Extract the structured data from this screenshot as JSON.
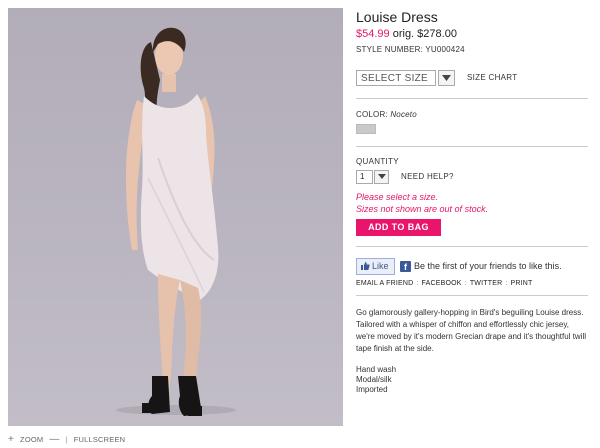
{
  "product": {
    "title": "Louise Dress",
    "sale_price": "$54.99",
    "orig_price": "orig. $278.00",
    "style_number": "STYLE NUMBER: YU000424"
  },
  "size": {
    "select_value": "SELECT SIZE",
    "size_chart_label": "SIZE CHART"
  },
  "color": {
    "label": "COLOR:",
    "name": "Noceto",
    "swatch_color": "#c9c9cb"
  },
  "quantity": {
    "label": "QUANTITY",
    "value": "1",
    "need_help_label": "NEED HELP?"
  },
  "messages": {
    "select_size": "Please select a size.",
    "out_of_stock": "Sizes not shown are out of stock."
  },
  "cart": {
    "add_to_bag_label": "ADD TO BAG"
  },
  "social": {
    "like_label": "Like",
    "fb_text": "Be the first of your friends to like this.",
    "email_friend": "EMAIL A FRIEND",
    "facebook": "FACEBOOK",
    "twitter": "TWITTER",
    "print": "PRINT",
    "separator": ":"
  },
  "description": {
    "text": "Go glamorously gallery-hopping in Bird's beguiling Louise dress. Tailored with a whisper of chiffon and effortlessly chic jersey, we're moved by it's modern Grecian drape and it's thoughtful twill tape finish at the side.",
    "care": [
      "Hand wash",
      "Modal/silk",
      "Imported"
    ]
  },
  "image_controls": {
    "zoom_plus": "+",
    "zoom_label": "ZOOM",
    "zoom_minus": "—",
    "divider": "|",
    "fullscreen_label": "FULLSCREEN"
  },
  "colors": {
    "accent": "#e5166a",
    "button_bg": "#e8156b",
    "facebook_blue": "#3b5998",
    "image_bg": "#b2adb9"
  }
}
